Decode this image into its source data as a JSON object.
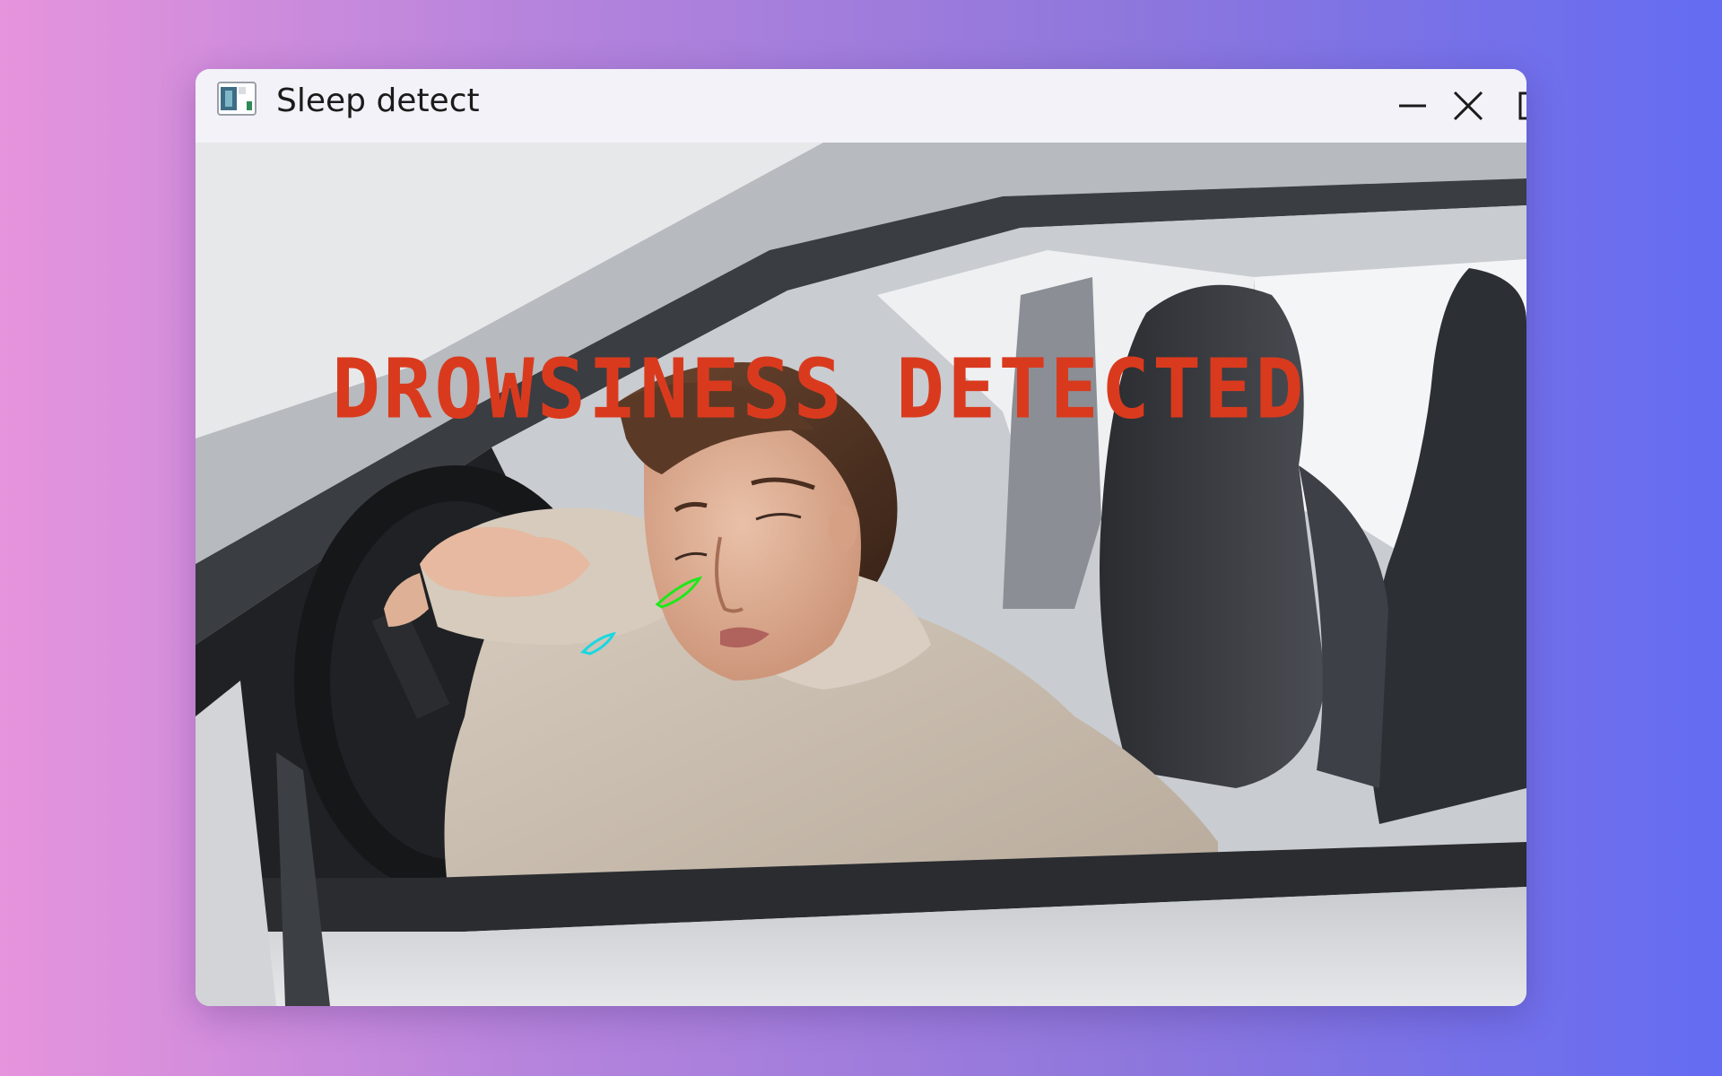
{
  "window": {
    "title": "Sleep detect",
    "controls": {
      "minimize": "minimize-icon",
      "maximize": "maximize-icon",
      "close": "close-icon"
    }
  },
  "frame": {
    "alert_text": "DROWSINESS DETECTED",
    "alert_color": "#d93a1e",
    "left_eye_contour_color": "#19d8e0",
    "right_eye_contour_color": "#1ee81a"
  },
  "colors": {
    "background_gradient_start": "#e694dc",
    "background_gradient_end": "#646cf2",
    "titlebar": "#f3f2f8"
  }
}
